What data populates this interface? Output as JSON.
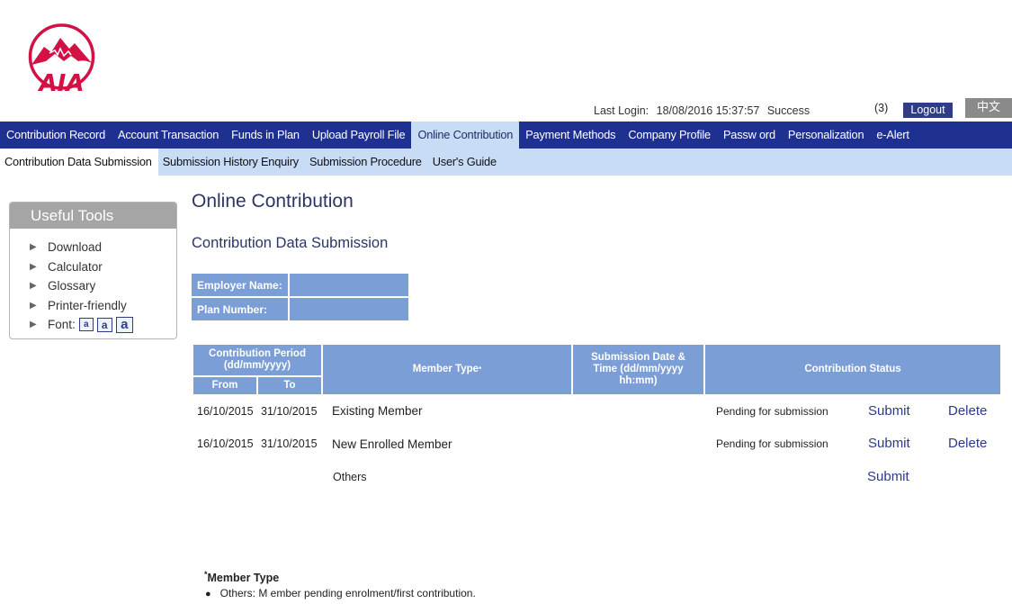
{
  "header": {
    "logo_text": "AIA",
    "last_login_label": "Last Login:",
    "last_login_value": "18/08/2016 15:37:57",
    "login_status": "Success",
    "message_count": "(3)",
    "logout_label": "Logout",
    "language_label": "中文",
    "colors": {
      "brand_red": "#d31145",
      "nav_blue": "#1e3190",
      "sub_nav": "#c8dcf5",
      "table_head": "#7b9ed6"
    }
  },
  "nav_main": [
    {
      "label": "Contribution Record"
    },
    {
      "label": "Account Transaction"
    },
    {
      "label": "Funds in Plan"
    },
    {
      "label": "Upload Payroll File"
    },
    {
      "label": "Online Contribution",
      "active": true
    },
    {
      "label": "Payment Methods"
    },
    {
      "label": "Company Profile"
    },
    {
      "label": "Passw ord"
    },
    {
      "label": "Personalization"
    },
    {
      "label": "e-Alert"
    }
  ],
  "nav_sub": [
    {
      "label": "Contribution Data Submission",
      "active": true
    },
    {
      "label": "Submission History Enquiry"
    },
    {
      "label": "Submission Procedure"
    },
    {
      "label": "User's Guide"
    }
  ],
  "tools": {
    "title": "Useful Tools",
    "items": [
      "Download",
      "Calculator",
      "Glossary",
      "Printer-friendly"
    ],
    "font_label": "Font:",
    "font_sizes": [
      "a",
      "a",
      "a"
    ],
    "arrow_icon": "triangle-right-icon"
  },
  "page": {
    "title": "Online Contribution",
    "section_title": "Contribution Data Submission"
  },
  "info": {
    "employer_label": "Employer Name:",
    "employer_value": "",
    "plan_label": "Plan Number:",
    "plan_value": ""
  },
  "table": {
    "headers": {
      "period": "Contribution Period (dd/mm/yyyy)",
      "from": "From",
      "to": "To",
      "member_type": "Member Type",
      "member_type_mark": "*",
      "submission_date": "Submission Date & Time (dd/mm/yyyy hh:mm)",
      "status": "Contribution Status"
    },
    "rows": [
      {
        "from": "16/10/2015",
        "to": "31/10/2015",
        "member_type": "Existing Member",
        "submission_date": "",
        "status": "Pending for submission",
        "submit": "Submit",
        "delete": "Delete"
      },
      {
        "from": "16/10/2015",
        "to": "31/10/2015",
        "member_type": "New Enrolled Member",
        "submission_date": "",
        "status": "Pending for submission",
        "submit": "Submit",
        "delete": "Delete"
      },
      {
        "from": "",
        "to": "",
        "member_type": "Others",
        "submission_date": "",
        "status": "",
        "submit": "Submit"
      }
    ]
  },
  "notes": {
    "mark": "*",
    "title": "Member Type",
    "items": [
      "Others: M ember pending enrolment/first contribution."
    ]
  }
}
